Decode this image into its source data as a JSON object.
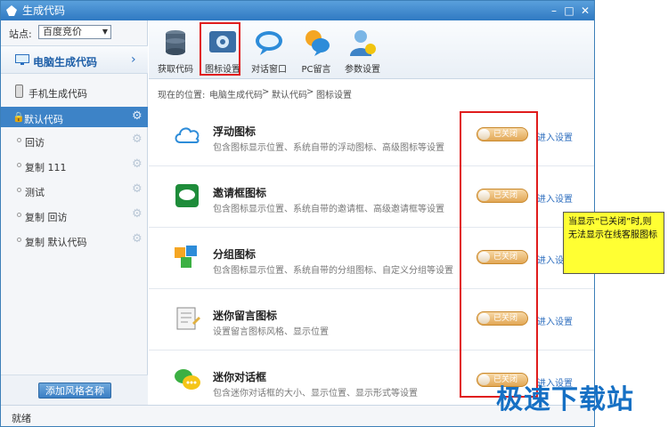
{
  "window": {
    "title": "生成代码"
  },
  "sidebar": {
    "site_label": "站点:",
    "site_value": "百度竞价",
    "pc_label": "电脑生成代码",
    "mobile_label": "手机生成代码",
    "default_style": "默认代码",
    "styles": [
      "回访",
      "复制 111",
      "测试",
      "复制 回访",
      "复制 默认代码"
    ],
    "add_style_button": "添加风格名称"
  },
  "toolbar": [
    {
      "label": "获取代码",
      "icon": "database-icon"
    },
    {
      "label": "图标设置",
      "icon": "settings-icon"
    },
    {
      "label": "对话窗口",
      "icon": "chat-window-icon"
    },
    {
      "label": "PC留言",
      "icon": "pc-message-icon"
    },
    {
      "label": "参数设置",
      "icon": "user-settings-icon"
    }
  ],
  "breadcrumb": {
    "prefix": "现在的位置:",
    "items": [
      "电脑生成代码",
      "默认代码",
      "图标设置"
    ],
    "sep": ">"
  },
  "rows": [
    {
      "title": "浮动图标",
      "desc": "包含图标显示位置、系统自带的浮动图标、高级图标等设置",
      "toggle": "已关闭",
      "link": "进入设置",
      "icon": "cloud-icon"
    },
    {
      "title": "邀请框图标",
      "desc": "包含图标显示位置、系统自带的邀请框、高级邀请框等设置",
      "toggle": "已关闭",
      "link": "进入设置",
      "icon": "invite-icon"
    },
    {
      "title": "分组图标",
      "desc": "包含图标显示位置、系统自带的分组图标、自定义分组等设置",
      "toggle": "已关闭",
      "link": "进入设置",
      "icon": "group-cubes-icon"
    },
    {
      "title": "迷你留言图标",
      "desc": "设置留言图标风格、显示位置",
      "toggle": "已关闭",
      "link": "进入设置",
      "icon": "note-icon"
    },
    {
      "title": "迷你对话框",
      "desc": "包含迷你对话框的大小、显示位置、显示形式等设置",
      "toggle": "已关闭",
      "link": "进入设置",
      "icon": "mini-chat-icon"
    }
  ],
  "status": "就绪",
  "callout": "当显示“已关闭”时,则无法显示在线客服图标",
  "watermark": "极速下载站",
  "colors": {
    "accent": "#3d83c7",
    "highlight": "#e01c1c",
    "callout": "#ffff33",
    "toggle": "#e2a755"
  }
}
